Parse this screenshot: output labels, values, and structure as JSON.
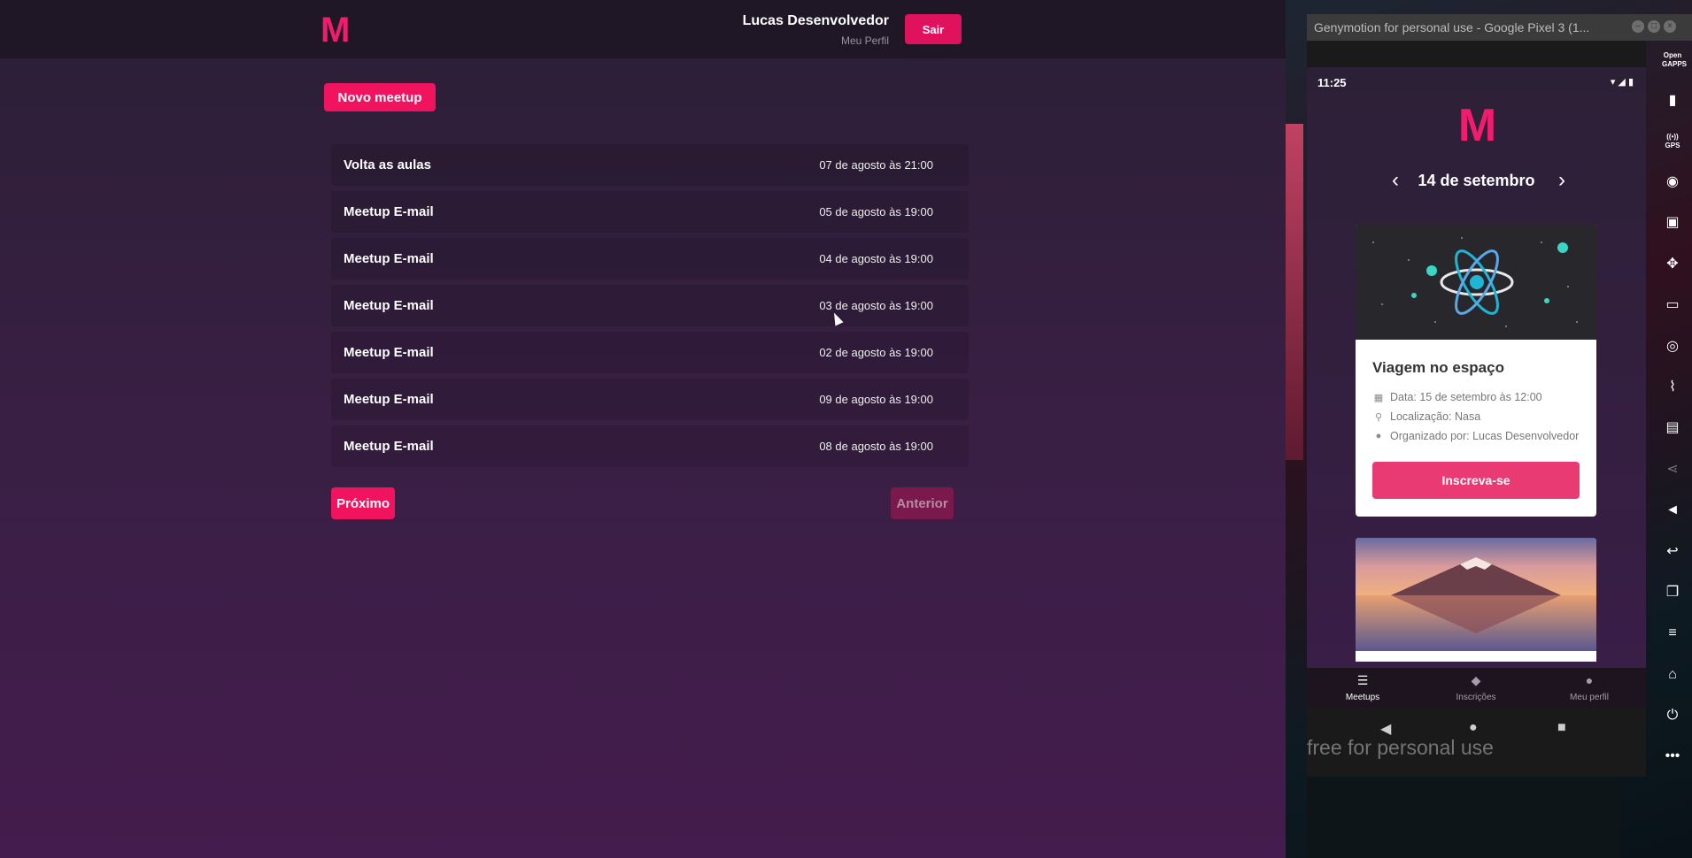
{
  "web": {
    "logo": "M",
    "user_name": "Lucas Desenvolvedor",
    "user_profile_link": "Meu Perfil",
    "logout_label": "Sair",
    "new_meetup_label": "Novo meetup",
    "meetups": [
      {
        "title": "Volta as aulas",
        "date": "07 de agosto às 21:00"
      },
      {
        "title": "Meetup E-mail",
        "date": "05 de agosto às 19:00"
      },
      {
        "title": "Meetup E-mail",
        "date": "04 de agosto às 19:00"
      },
      {
        "title": "Meetup E-mail",
        "date": "03 de agosto às 19:00"
      },
      {
        "title": "Meetup E-mail",
        "date": "02 de agosto às 19:00"
      },
      {
        "title": "Meetup E-mail",
        "date": "09 de agosto às 19:00"
      },
      {
        "title": "Meetup E-mail",
        "date": "08 de agosto às 19:00"
      }
    ],
    "next_label": "Próximo",
    "prev_label": "Anterior"
  },
  "emulator": {
    "window_title": "Genymotion for personal use - Google Pixel 3 (1...",
    "watermark": "free for personal use",
    "side_tools": [
      {
        "icon": "opengapps-icon",
        "label": "Open GAPPS"
      },
      {
        "icon": "battery-icon"
      },
      {
        "icon": "gps-icon",
        "label": "GPS"
      },
      {
        "icon": "webcam-icon"
      },
      {
        "icon": "capture-icon"
      },
      {
        "icon": "move-icon"
      },
      {
        "icon": "identifiers-icon"
      },
      {
        "icon": "disk-io-icon"
      },
      {
        "icon": "network-icon"
      },
      {
        "icon": "sms-icon"
      },
      {
        "icon": "share-icon"
      },
      {
        "icon": "volume-up-icon"
      },
      {
        "icon": "back-icon"
      },
      {
        "icon": "recent-apps-icon"
      },
      {
        "icon": "menu-icon"
      },
      {
        "icon": "home-icon"
      },
      {
        "icon": "power-icon"
      },
      {
        "icon": "more-icon"
      }
    ]
  },
  "phone": {
    "time": "11:25",
    "logo": "M",
    "day_label": "14 de setembro",
    "card": {
      "title": "Viagem no espaço",
      "date": "Data: 15 de setembro às 12:00",
      "location": "Localização: Nasa",
      "organizer": "Organizado por: Lucas Desenvolvedor",
      "button": "Inscreva-se"
    },
    "tabs": [
      {
        "label": "Meetups",
        "icon": "list-icon",
        "active": true
      },
      {
        "label": "Inscrições",
        "icon": "tag-icon",
        "active": false
      },
      {
        "label": "Meu perfil",
        "icon": "person-icon",
        "active": false
      }
    ]
  },
  "colors": {
    "accent": "#f2135e",
    "header_bg": "#1f1726",
    "card_button": "#ea3a74"
  }
}
